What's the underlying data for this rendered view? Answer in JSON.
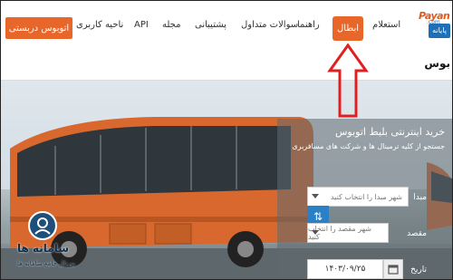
{
  "nav": {
    "bus_button": "اتوبوس دربستی",
    "items": [
      "ناحیه کاربری",
      "API",
      "مجله",
      "پشتیبانی",
      "سوالات متداول",
      "راهنما",
      "ابطال",
      "استعلام"
    ],
    "logo_text": "Payan",
    "logo_com": ".com",
    "logo_box": "پایانه"
  },
  "page_heading": "بوس",
  "panel": {
    "title": "خرید اینترنتی بلیط اتوبوس",
    "subtitle": "جستجو از کلیه ترمینال ها و شرکت های مسافربری",
    "origin_label": "مبدا",
    "origin_placeholder": "شهر مبدا را انتخاب کنید",
    "dest_label": "مقصد",
    "dest_placeholder": "شهر مقصد را انتخاب کنید",
    "date_label": "تاریخ",
    "date_value": "۱۴۰۳/۰۹/۲۵",
    "swap_icon": "⇅"
  },
  "watermark": {
    "title": "سامانه ها",
    "sub": "پورتال جامع سامانه ها"
  },
  "colors": {
    "accent": "#e8662a",
    "arrow": "#e02020",
    "swap": "#2a7fc5"
  }
}
